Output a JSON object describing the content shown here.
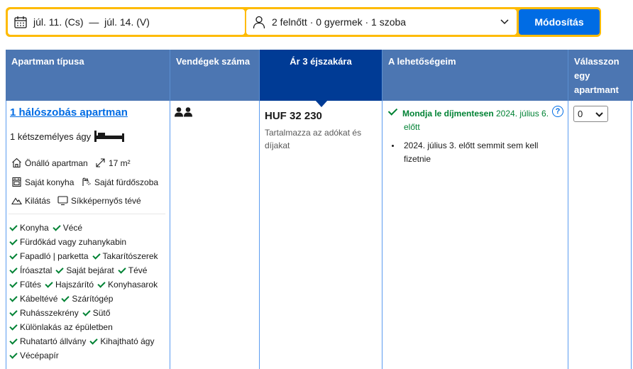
{
  "search": {
    "dates": "júl. 11. (Cs)  —  júl. 14. (V)",
    "guests": "2 felnőtt · 0 gyermek · 1 szoba",
    "button": "Módosítás"
  },
  "table": {
    "headers": {
      "type": "Apartman típusa",
      "guests": "Vendégek száma",
      "price": "Ár 3 éjszakára",
      "options": "A lehetőségeim",
      "select": "Válasszon egy apartmant"
    }
  },
  "room": {
    "title": "1 hálószobás apartman",
    "bed": "1 kétszemélyes ágy",
    "features": {
      "apartment": "Önálló apartman",
      "size": "17 m²",
      "kitchen": "Saját konyha",
      "bathroom": "Saját fürdőszoba",
      "view": "Kilátás",
      "tv": "Síkképernyős tévé"
    },
    "amenities": [
      [
        "Konyha",
        "Vécé"
      ],
      [
        "Fürdőkád vagy zuhanykabin"
      ],
      [
        "Fapadló | parketta",
        "Takarítószerek"
      ],
      [
        "Íróasztal",
        "Saját bejárat",
        "Tévé"
      ],
      [
        "Fűtés",
        "Hajszárító",
        "Konyhasarok"
      ],
      [
        "Kábeltévé",
        "Szárítógép"
      ],
      [
        "Ruhásszekrény",
        "Sütő"
      ],
      [
        "Különlakás az épületben"
      ],
      [
        "Ruhatartó állvány",
        "Kihajtható ágy"
      ],
      [
        "Vécépapír"
      ]
    ]
  },
  "price": {
    "amount": "HUF 32 230",
    "note": "Tartalmazza az adókat és díjakat"
  },
  "options": {
    "free_cancel_bold": "Mondja le díjmentesen",
    "free_cancel_date": "2024. július 6. előtt",
    "no_prepay": "2024. július 3. előtt semmit sem kell fizetnie",
    "info_icon": "?"
  },
  "select": {
    "value": "0"
  }
}
